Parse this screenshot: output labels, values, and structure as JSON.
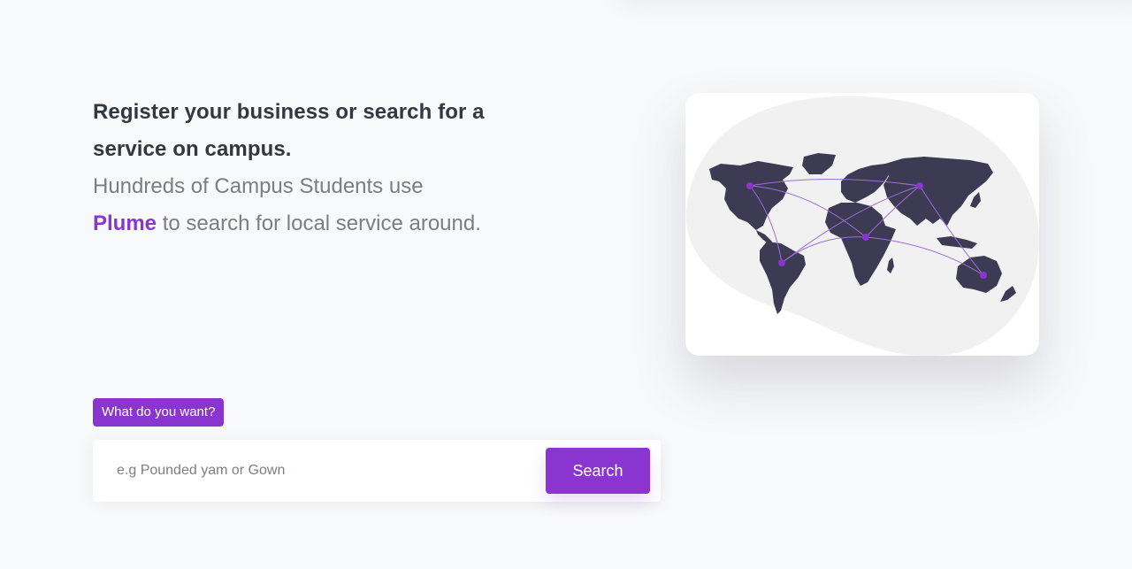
{
  "hero": {
    "headline_line1": "Register your business or search for a",
    "headline_line2": "service on campus.",
    "subline_line1": "Hundreds of Campus Students use",
    "brand_name": "Plume",
    "subline_rest": " to search for local service around."
  },
  "search": {
    "tag_label": "What do you want?",
    "placeholder": "e.g Pounded yam or Gown",
    "value": "",
    "button_label": "Search"
  },
  "colors": {
    "accent": "#8a35d0",
    "map_land": "#3d3a54",
    "blob": "#f1f1f2",
    "route": "#9b6fd8"
  },
  "illustration": {
    "icon": "world-map-network-icon"
  }
}
